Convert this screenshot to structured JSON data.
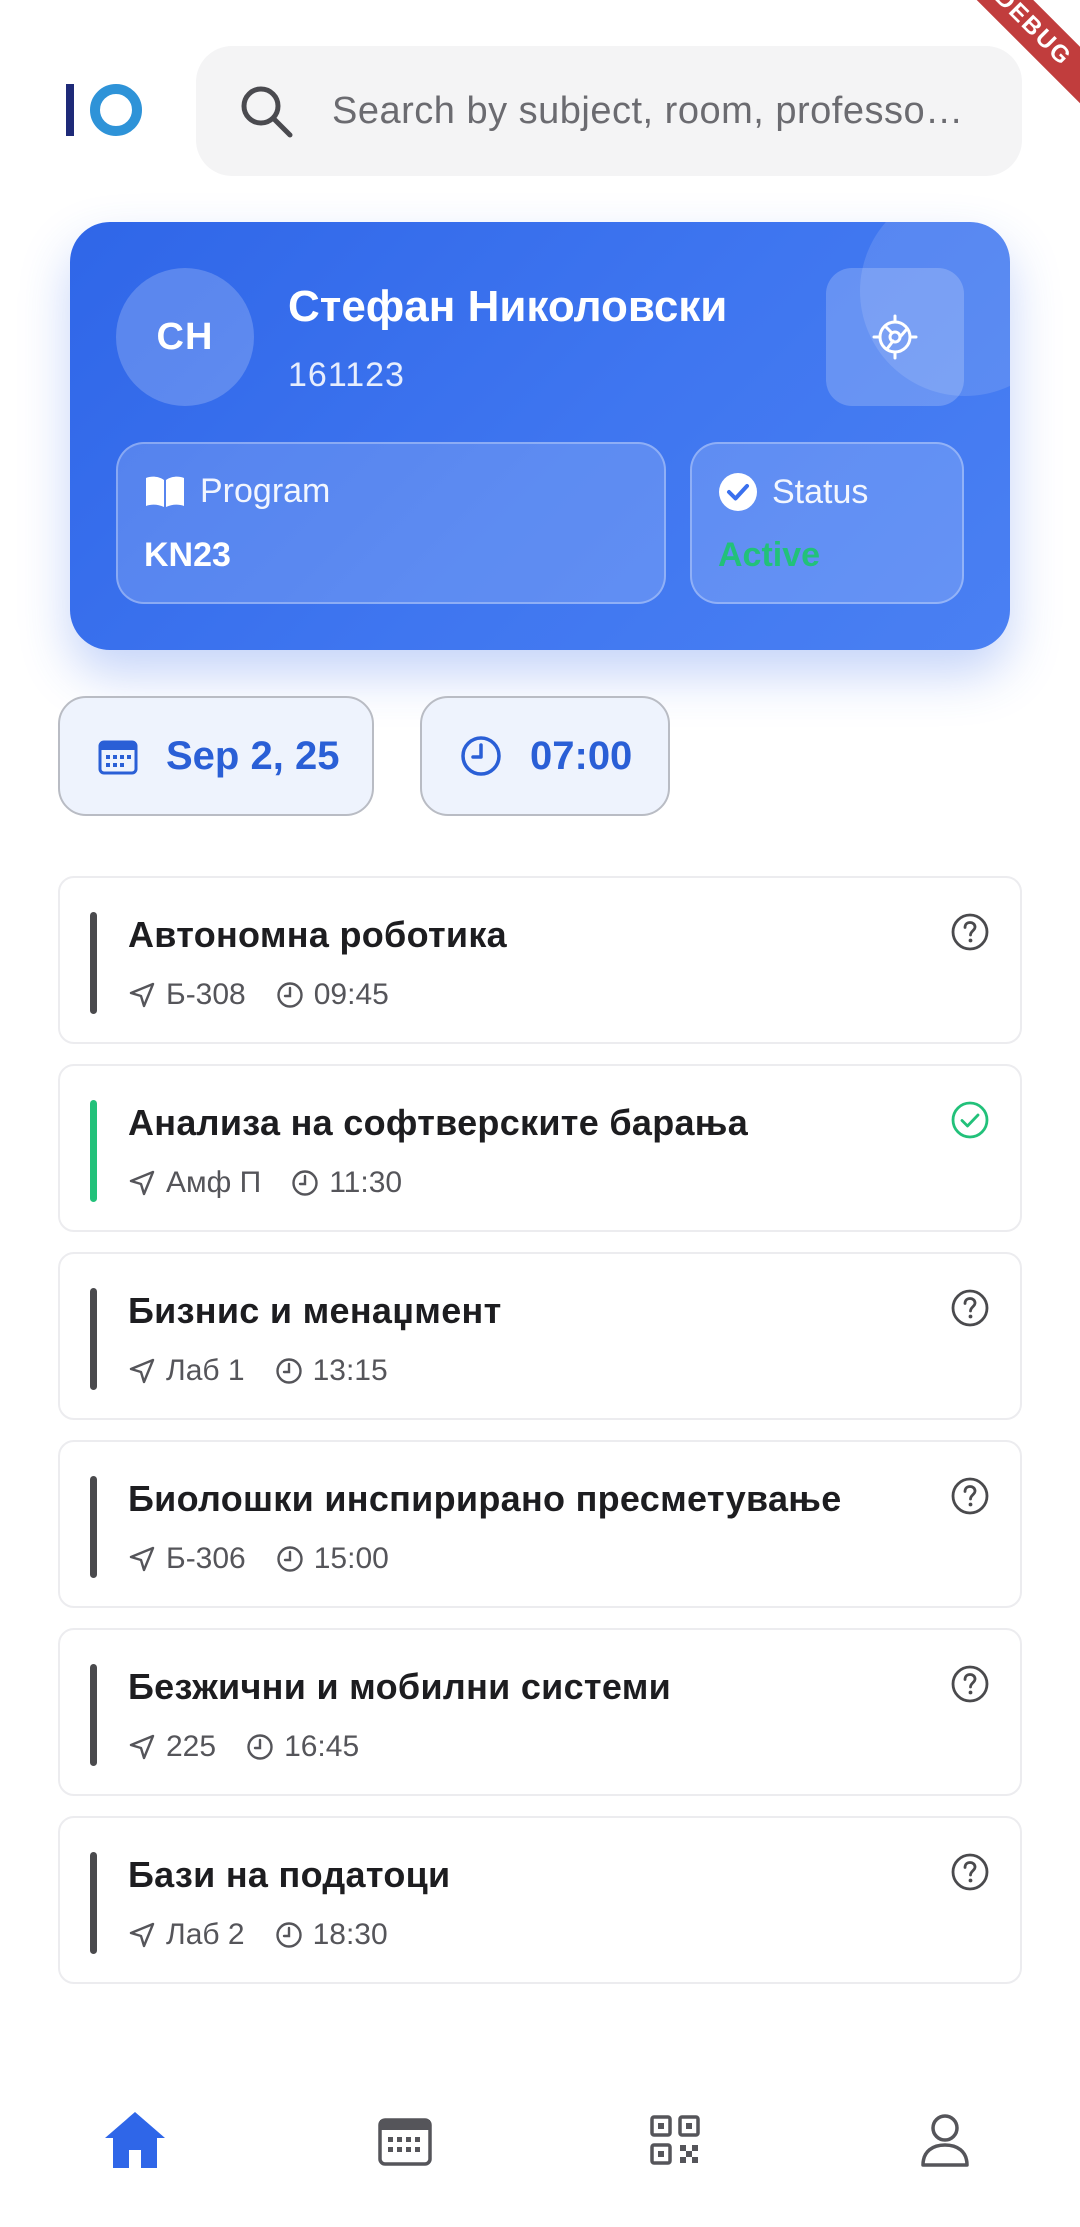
{
  "header": {
    "logo_text": "IO",
    "search": {
      "placeholder": "Search by subject, room, professo…"
    }
  },
  "profile": {
    "initials": "СН",
    "name": "Стефан Николовски",
    "student_id": "161123",
    "program": {
      "label": "Program",
      "value": "KN23"
    },
    "status": {
      "label": "Status",
      "value": "Active",
      "color": "#22c17a"
    }
  },
  "filters": {
    "date": "Sep 2, 25",
    "time": "07:00"
  },
  "courses": [
    {
      "title": "Автономна роботика",
      "room": "Б-308",
      "time": "09:45",
      "status": "unknown",
      "status_icon": "question-circle-icon"
    },
    {
      "title": "Анализа на софтверските барања",
      "room": "Амф П",
      "time": "11:30",
      "status": "attended",
      "status_icon": "check-circle-icon"
    },
    {
      "title": "Бизнис и менаџмент",
      "room": "Лаб 1",
      "time": "13:15",
      "status": "unknown",
      "status_icon": "question-circle-icon"
    },
    {
      "title": "Биолошки инспирирано пресметување",
      "room": "Б-306",
      "time": "15:00",
      "status": "unknown",
      "status_icon": "question-circle-icon"
    },
    {
      "title": "Безжични и мобилни системи",
      "room": "225",
      "time": "16:45",
      "status": "unknown",
      "status_icon": "question-circle-icon"
    },
    {
      "title": "Бази на податоци",
      "room": "Лаб 2",
      "time": "18:30",
      "status": "unknown",
      "status_icon": "question-circle-icon"
    }
  ],
  "bottom_nav": [
    {
      "icon": "home-icon",
      "active": true
    },
    {
      "icon": "calendar-icon",
      "active": false
    },
    {
      "icon": "qr-code-icon",
      "active": false
    },
    {
      "icon": "person-icon",
      "active": false
    }
  ],
  "debug_banner": "DEBUG",
  "colors": {
    "accent": "#2f66e8",
    "success": "#22c17a",
    "chip_text": "#2a5fd6",
    "muted_bar": "#4a4a4d"
  }
}
